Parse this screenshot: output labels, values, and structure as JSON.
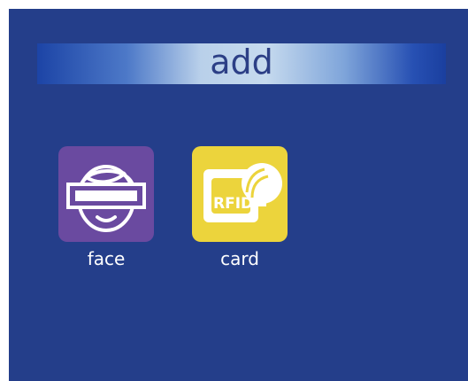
{
  "header": {
    "title": "add"
  },
  "menu": {
    "items": [
      {
        "label": "face",
        "icon": "face-scan-icon",
        "tile_color": "#6a4aa0"
      },
      {
        "label": "card",
        "icon": "rfid-card-icon",
        "tile_color": "#ecd43c"
      }
    ]
  },
  "colors": {
    "screen_background": "#243e8a",
    "title_text": "#2c3f86",
    "label_text": "#ffffff"
  }
}
